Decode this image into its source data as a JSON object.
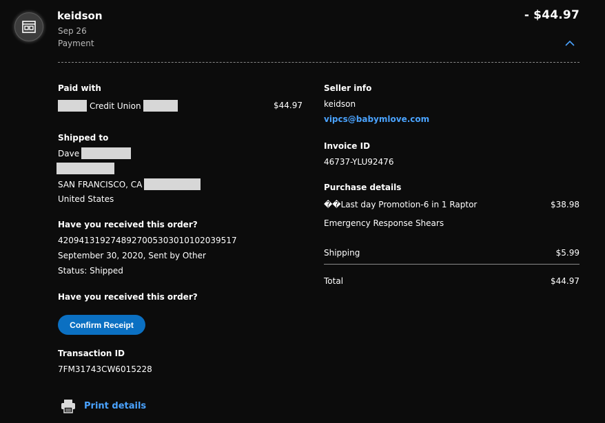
{
  "header": {
    "merchant_name": "keidson",
    "date": "Sep 26",
    "type": "Payment",
    "amount": "- $44.97"
  },
  "paid_with": {
    "label": "Paid with",
    "source": "Credit Union",
    "amount": "$44.97"
  },
  "shipped_to": {
    "label": "Shipped to",
    "name": "Dave",
    "city_state": "SAN FRANCISCO, CA",
    "country": "United States"
  },
  "tracking": {
    "question": "Have you received this order?",
    "number": "420941319274892700530301010203951​7",
    "sent": "September 30, 2020, Sent by Other",
    "status": "Status: Shipped"
  },
  "receipt": {
    "question": "Have you received this order?",
    "button": "Confirm Receipt"
  },
  "transaction": {
    "label": "Transaction ID",
    "id": "7FM31743CW6015228"
  },
  "print": {
    "label": "Print details",
    "icon": "printer-icon"
  },
  "seller": {
    "label": "Seller info",
    "name": "keidson",
    "email": "vipcs@babymlove.com"
  },
  "invoice": {
    "label": "Invoice ID",
    "id": "46737-YLU92476"
  },
  "purchase": {
    "label": "Purchase details",
    "item_line1": "��Last day Promotion-6 in 1 Raptor",
    "item_line2": "Emergency Response Shears",
    "item_amount": "$38.98",
    "shipping_label": "Shipping",
    "shipping_amount": "$5.99",
    "total_label": "Total",
    "total_amount": "$44.97"
  },
  "colors": {
    "background": "#0c0c0c",
    "link": "#4aa3ff",
    "button": "#0b70c2"
  }
}
